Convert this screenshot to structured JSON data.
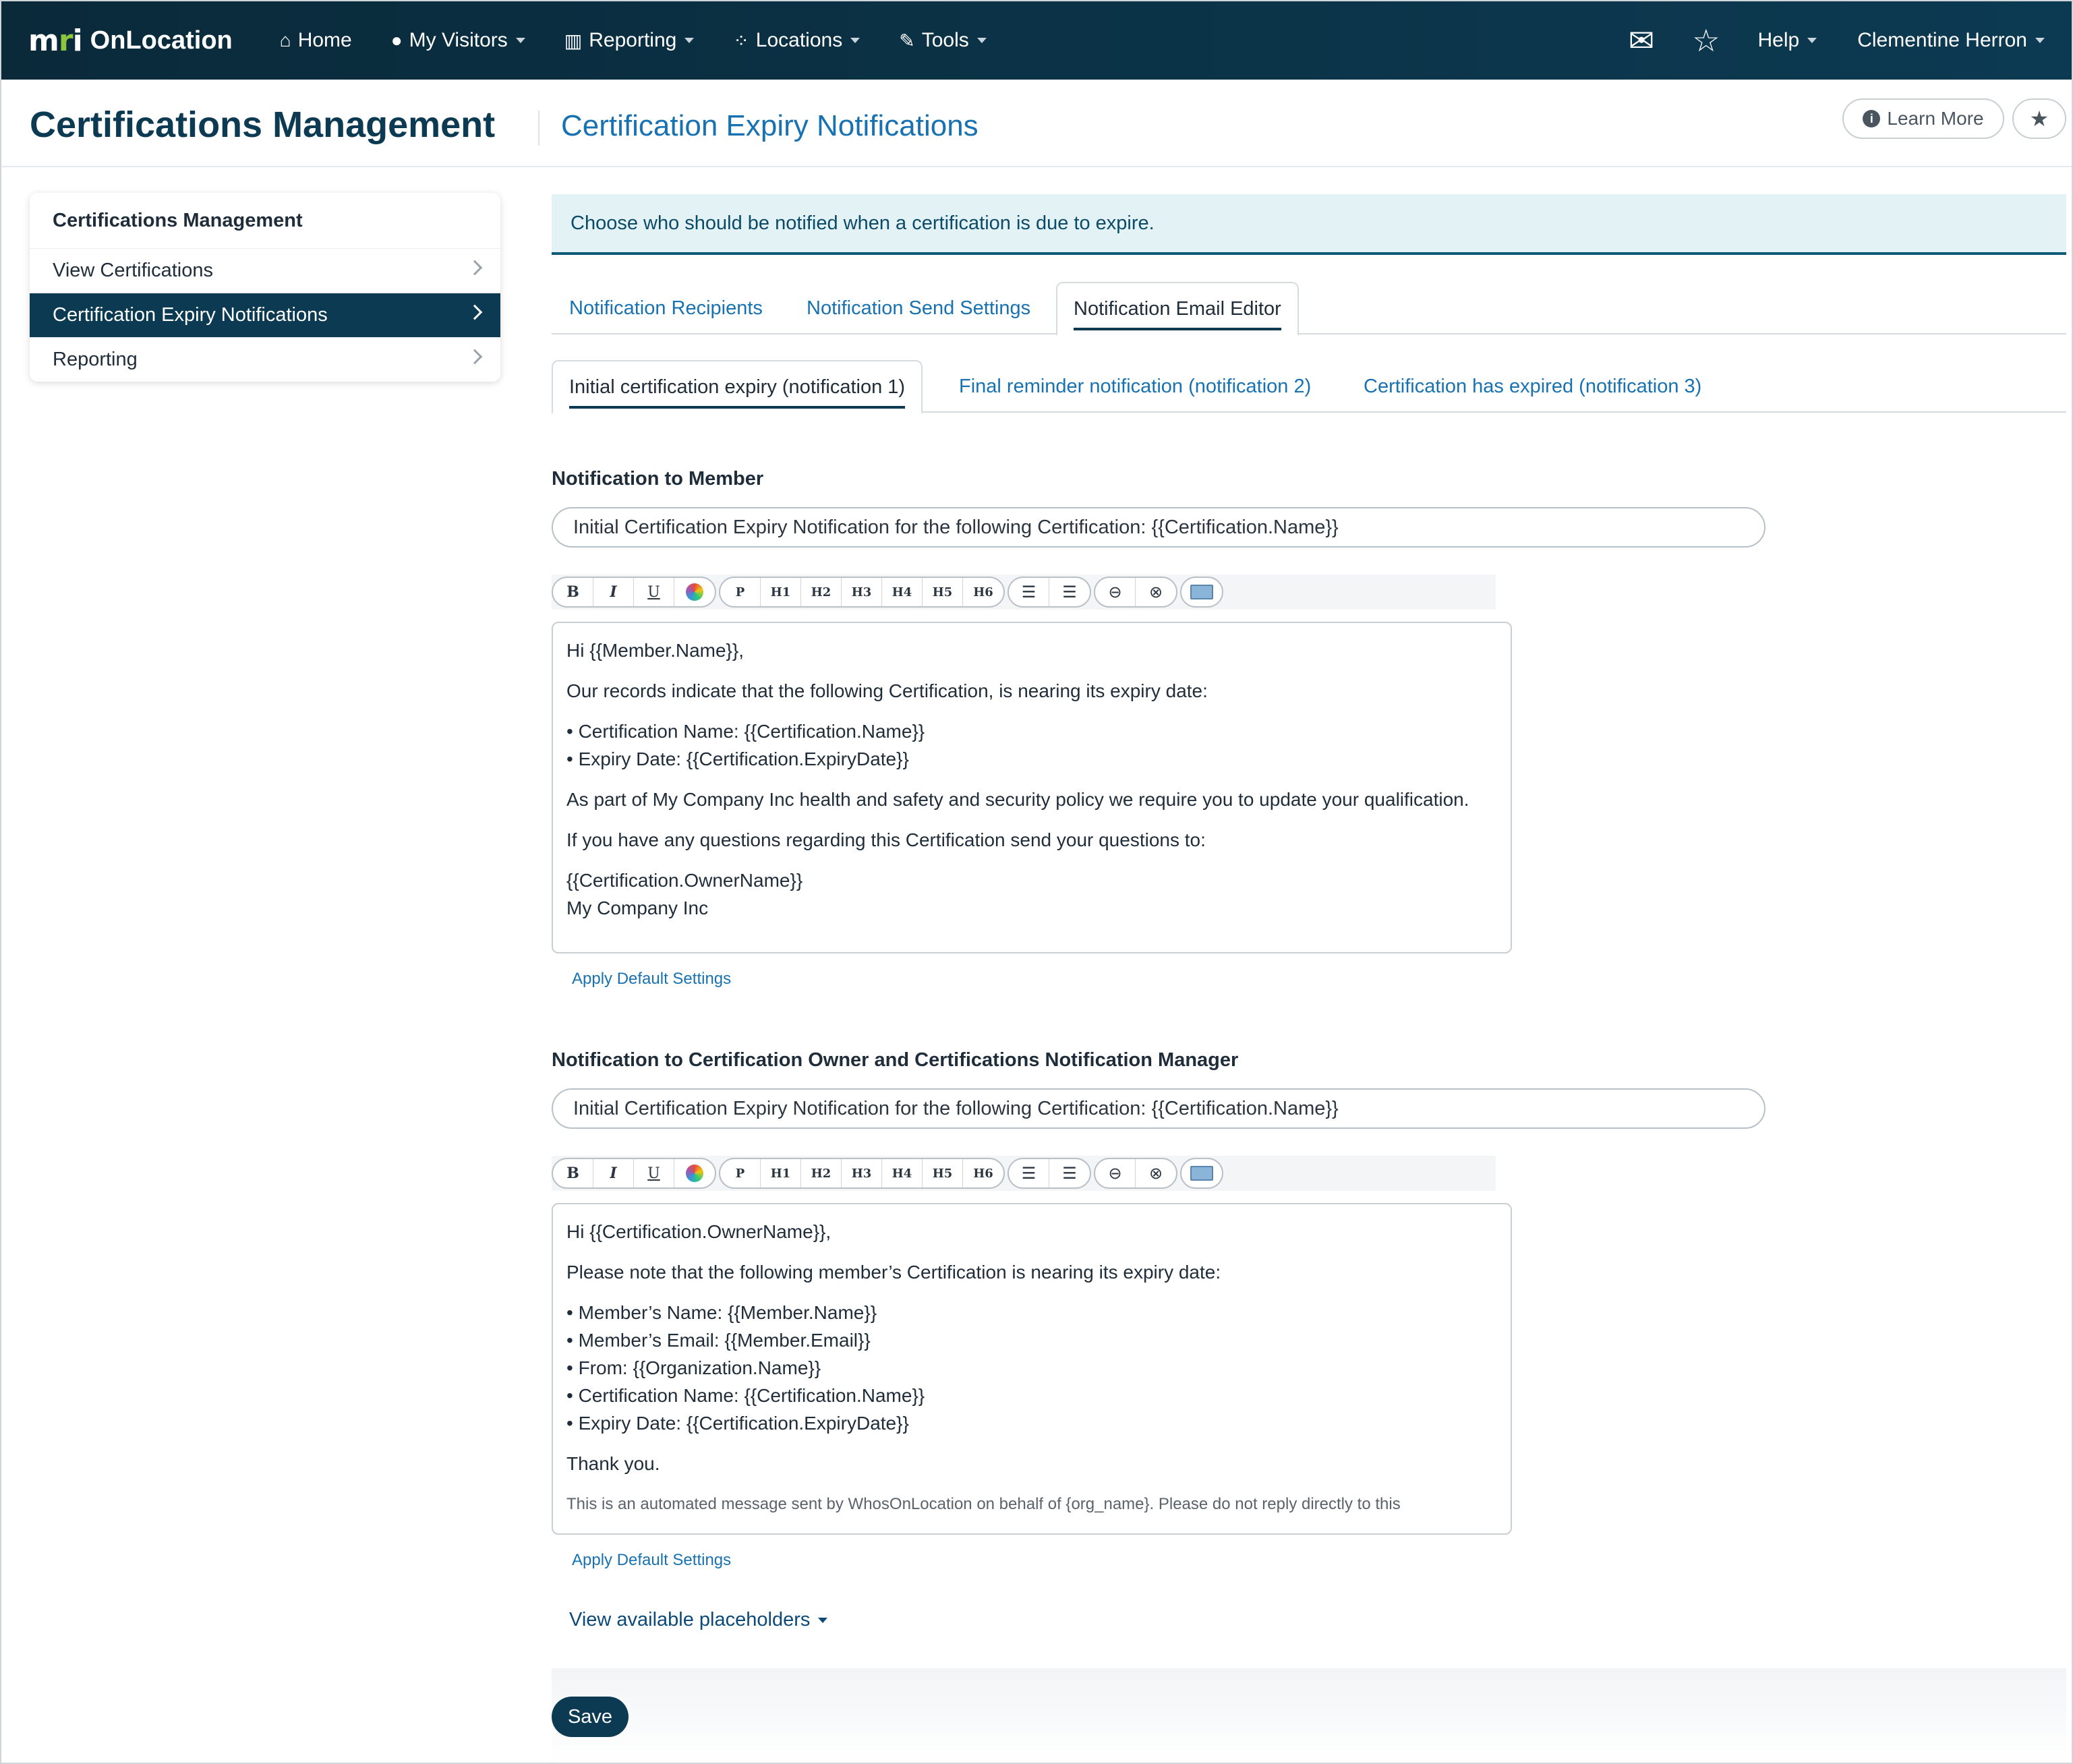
{
  "nav": {
    "logo_mark": "mri",
    "logo_text": "OnLocation",
    "items": [
      {
        "label": "Home",
        "icon": "home-icon",
        "glyph": "⌂",
        "dropdown": false
      },
      {
        "label": "My Visitors",
        "icon": "user-icon",
        "glyph": "👤",
        "dropdown": true
      },
      {
        "label": "Reporting",
        "icon": "bar-chart-icon",
        "glyph": "📊",
        "dropdown": true
      },
      {
        "label": "Locations",
        "icon": "network-icon",
        "glyph": "⁘",
        "dropdown": true
      },
      {
        "label": "Tools",
        "icon": "wrench-icon",
        "glyph": "🔧",
        "dropdown": true
      }
    ],
    "mail_icon": "envelope-icon",
    "star_icon": "star-outline-icon",
    "help_label": "Help",
    "user_name": "Clementine Herron"
  },
  "header": {
    "title": "Certifications Management",
    "subtitle": "Certification Expiry Notifications",
    "learn_more": "Learn More",
    "info_icon": "info-circle-icon",
    "favorite_icon": "star-icon"
  },
  "sidebar": {
    "heading": "Certifications Management",
    "items": [
      {
        "label": "View Certifications",
        "active": false
      },
      {
        "label": "Certification Expiry Notifications",
        "active": true
      },
      {
        "label": "Reporting",
        "active": false
      }
    ]
  },
  "banner": {
    "text": "Choose who should be notified when a certification is due to expire."
  },
  "tabs_primary": [
    {
      "label": "Notification Recipients",
      "active": false
    },
    {
      "label": "Notification Send Settings",
      "active": false
    },
    {
      "label": "Notification Email Editor",
      "active": true
    }
  ],
  "tabs_secondary": [
    {
      "label": "Initial certification expiry (notification 1)",
      "active": true
    },
    {
      "label": "Final reminder notification (notification 2)",
      "active": false
    },
    {
      "label": "Certification has expired (notification 3)",
      "active": false
    }
  ],
  "toolbar": {
    "bold": "B",
    "italic": "I",
    "underline": "U",
    "paragraph": "P",
    "h1": "H1",
    "h2": "H2",
    "h3": "H3",
    "h4": "H4",
    "h5": "H5",
    "h6": "H6",
    "ordered_list": "☰",
    "unordered_list": "☰",
    "link": "⊖",
    "unlink": "⊗"
  },
  "member_section": {
    "label": "Notification to Member",
    "subject": "Initial Certification Expiry Notification for the following Certification: {{Certification.Name}}",
    "body": {
      "greeting": "Hi {{Member.Name}},",
      "intro": "Our records indicate that the following Certification, is nearing its expiry date:",
      "bullet1": "• Certification Name: {{Certification.Name}}",
      "bullet2": "• Expiry Date: {{Certification.ExpiryDate}}",
      "policy": "As part of My Company Inc health and safety and security policy we require you to update your qualification.",
      "questions": "If you have any questions regarding this Certification send your questions to:",
      "owner": "{{Certification.OwnerName}}",
      "company": "My Company Inc"
    },
    "apply_default": "Apply Default Settings"
  },
  "owner_section": {
    "label": "Notification to Certification Owner and Certifications Notification Manager",
    "subject": "Initial Certification Expiry Notification for the following Certification: {{Certification.Name}}",
    "body": {
      "greeting": "Hi {{Certification.OwnerName}},",
      "intro": "Please note that the following member’s Certification is nearing its expiry date:",
      "bullet1": "• Member’s Name: {{Member.Name}}",
      "bullet2": "• Member’s Email: {{Member.Email}}",
      "bullet3": "• From: {{Organization.Name}}",
      "bullet4": "• Certification Name: {{Certification.Name}}",
      "bullet5": "• Expiry Date: {{Certification.ExpiryDate}}",
      "thanks": "Thank you.",
      "footer": "This is an automated message sent by WhosOnLocation on behalf of {org_name}. Please do not reply directly to this"
    },
    "apply_default": "Apply Default Settings"
  },
  "placeholders_link": "View available placeholders",
  "save_label": "Save"
}
